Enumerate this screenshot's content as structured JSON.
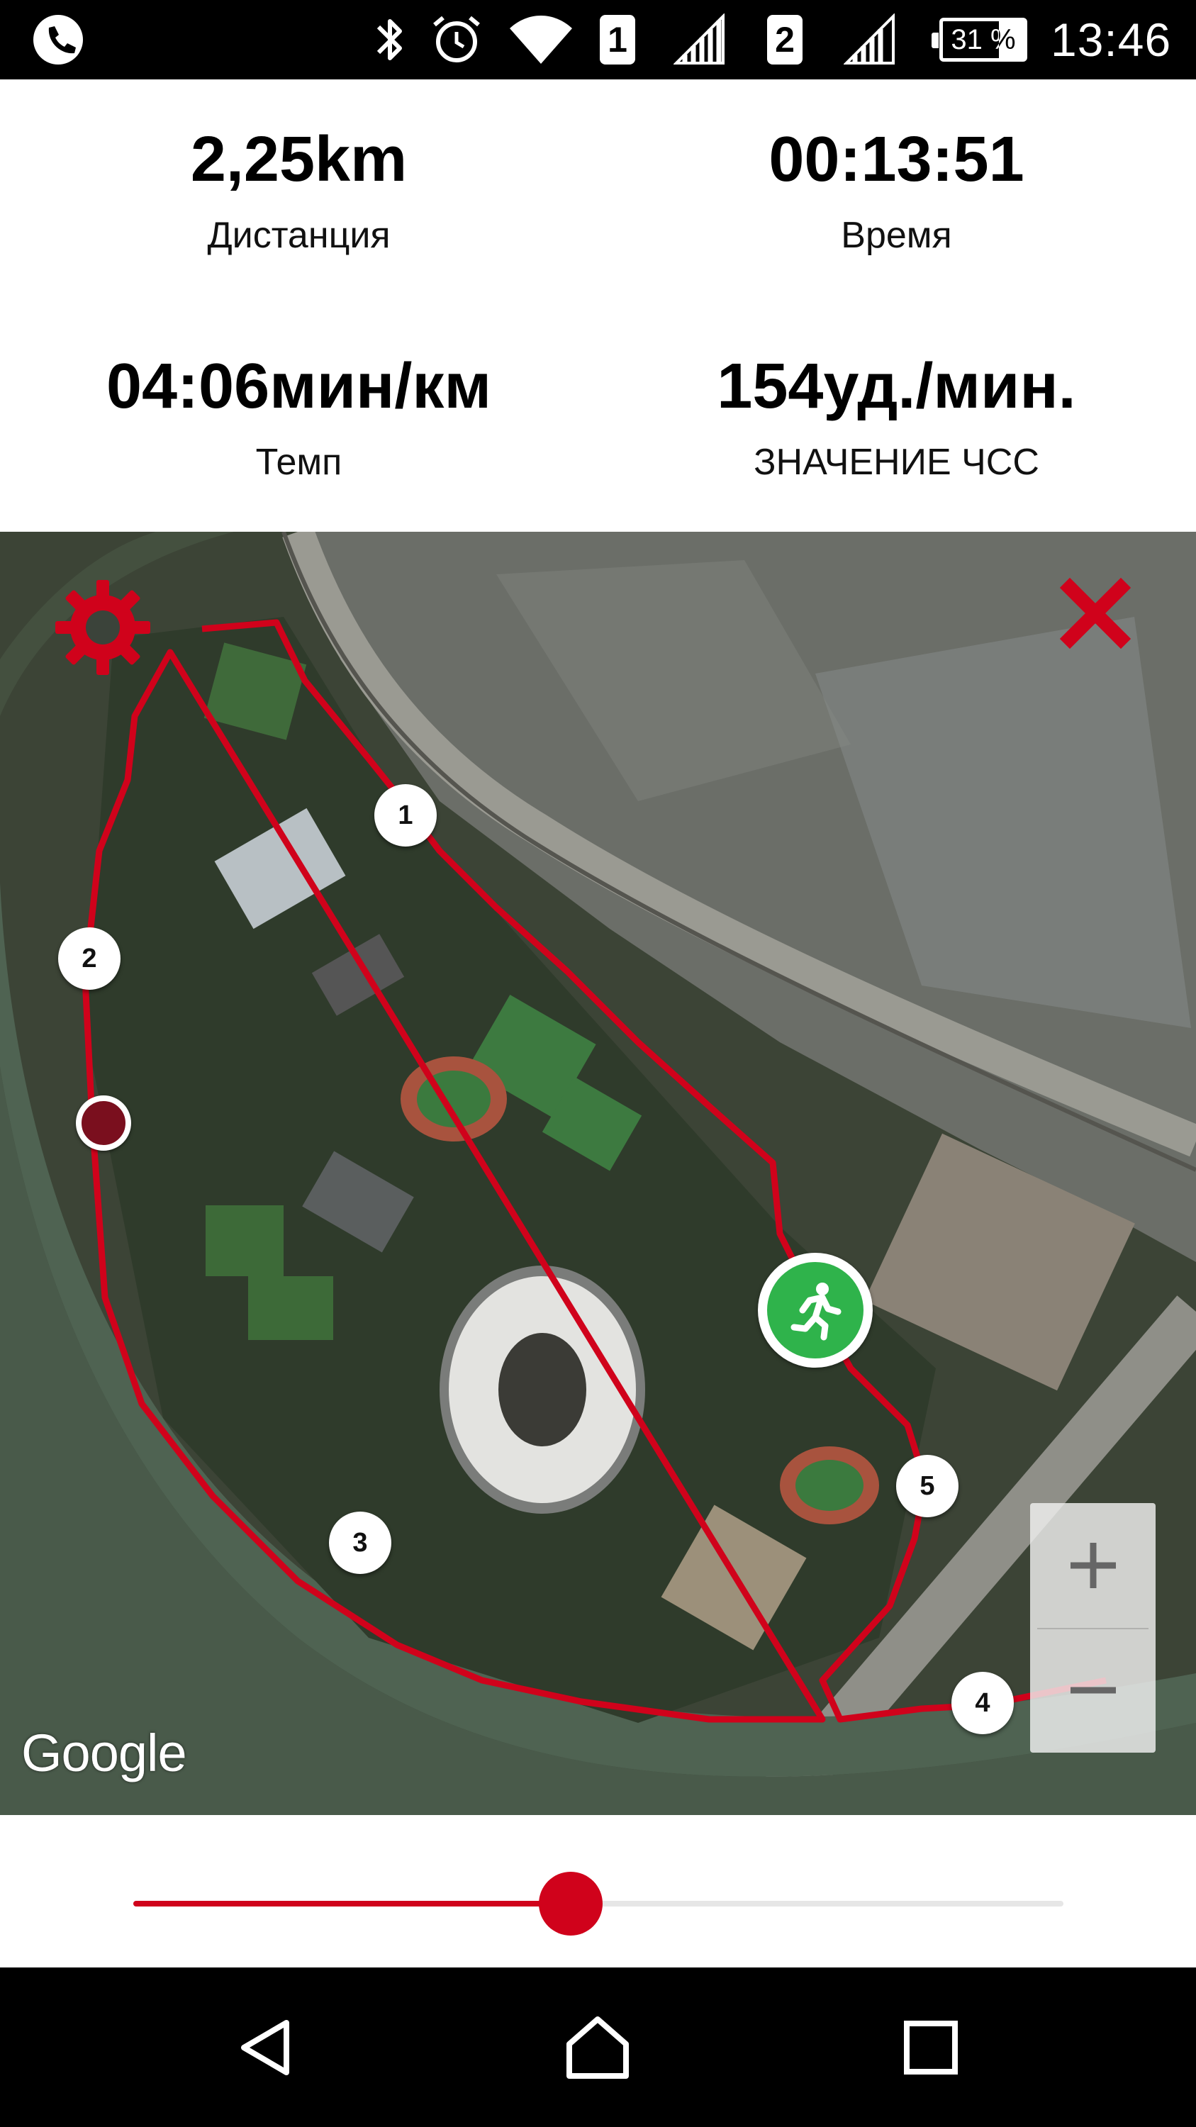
{
  "status_bar": {
    "time": "13:46",
    "battery": "31 %",
    "battery_level": 0.31,
    "sim1": "1",
    "sim2": "2",
    "icons": [
      "phone-icon",
      "bluetooth-icon",
      "alarm-icon",
      "wifi-icon",
      "signal-icon"
    ]
  },
  "stats": {
    "distance": {
      "value": "2,25km",
      "label": "Дистанция"
    },
    "time": {
      "value": "00:13:51",
      "label": "Время"
    },
    "pace": {
      "value": "04:06мин/км",
      "label": "Темп"
    },
    "heart_rate": {
      "value": "154уд./мин.",
      "label": "ЗНАЧЕНИЕ ЧСС"
    }
  },
  "map": {
    "attribution": "Google",
    "route_color": "#d0021b",
    "markers": [
      "1",
      "2",
      "3",
      "4",
      "5"
    ],
    "zoom_in_label": "+",
    "zoom_out_label": "−"
  },
  "playback": {
    "progress": 0.47,
    "accent": "#d0021b"
  },
  "navbar": {
    "icons": [
      "back-icon",
      "home-icon",
      "recents-icon"
    ]
  }
}
